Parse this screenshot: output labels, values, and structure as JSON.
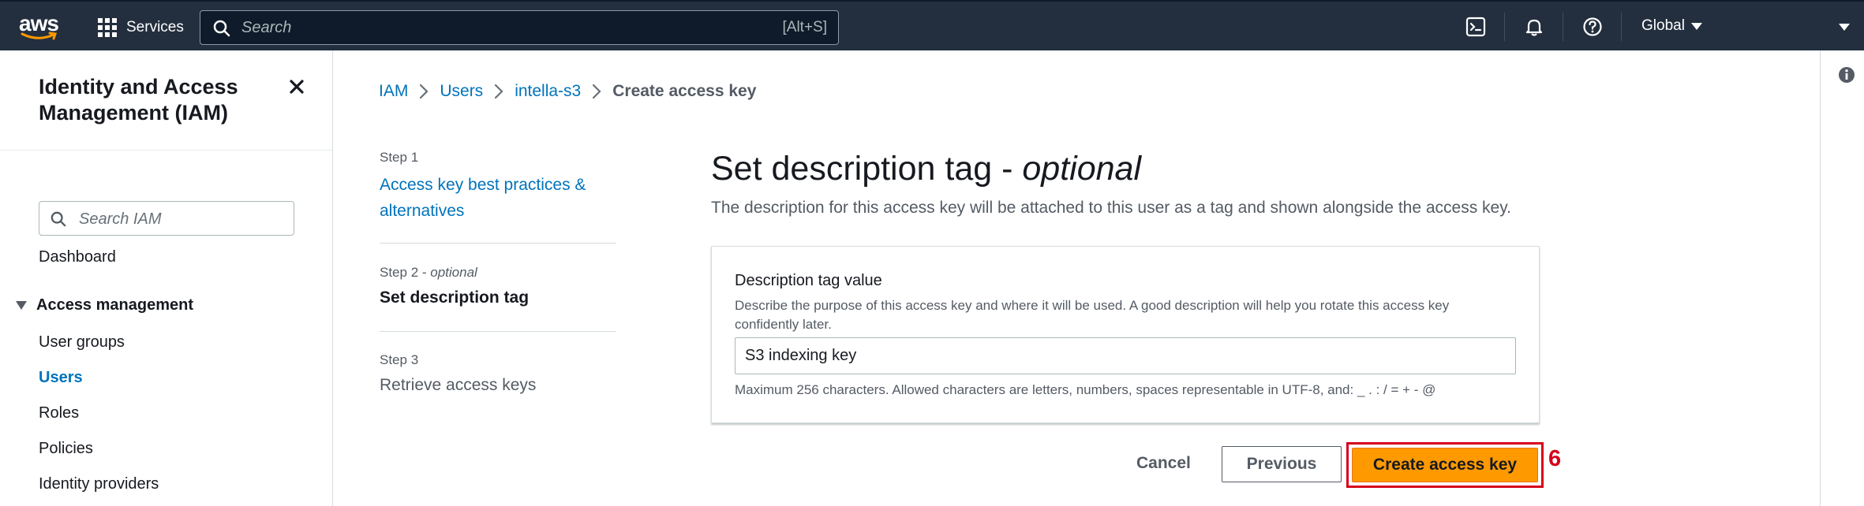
{
  "topnav": {
    "logo_text": "aws",
    "services_label": "Services",
    "search_placeholder": "Search",
    "search_hotkey": "[Alt+S]",
    "region_label": "Global"
  },
  "sidebar": {
    "title": "Identity and Access Management (IAM)",
    "search_placeholder": "Search IAM",
    "dashboard_label": "Dashboard",
    "section_label": "Access management",
    "items": [
      {
        "label": "User groups",
        "active": false
      },
      {
        "label": "Users",
        "active": true
      },
      {
        "label": "Roles",
        "active": false
      },
      {
        "label": "Policies",
        "active": false
      },
      {
        "label": "Identity providers",
        "active": false
      }
    ]
  },
  "breadcrumb": {
    "items": [
      "IAM",
      "Users",
      "intella-s3"
    ],
    "current": "Create access key"
  },
  "steps": [
    {
      "label": "Step 1",
      "title": "Access key best practices & alternatives"
    },
    {
      "label": "Step 2",
      "label_suffix": "optional",
      "title": "Set description tag"
    },
    {
      "label": "Step 3",
      "title": "Retrieve access keys"
    }
  ],
  "page": {
    "title": "Set description tag - ",
    "title_italic": "optional",
    "description": "The description for this access key will be attached to this user as a tag and shown alongside the access key."
  },
  "form": {
    "field_label": "Description tag value",
    "field_description": "Describe the purpose of this access key and where it will be used. A good description will help you rotate this access key confidently later.",
    "field_value": "S3 indexing key",
    "field_hint": "Maximum 256 characters. Allowed characters are letters, numbers, spaces representable in UTF-8, and: _ . : / = + - @"
  },
  "actions": {
    "cancel_label": "Cancel",
    "previous_label": "Previous",
    "primary_label": "Create access key",
    "annotation_number": "6"
  },
  "colors": {
    "nav_bg": "#232f3e",
    "link": "#0073bb",
    "primary": "#ff9900",
    "annotation": "#d6001c"
  },
  "icons": {
    "services": "grid-icon",
    "search": "search-icon",
    "cloudshell": "cloudshell-icon",
    "notifications": "bell-icon",
    "help": "help-icon",
    "close": "close-icon",
    "info": "info-icon"
  }
}
